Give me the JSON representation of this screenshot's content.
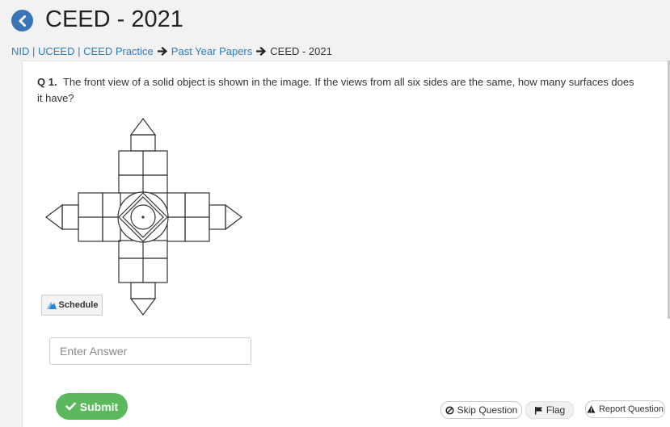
{
  "header": {
    "title": "CEED - 2021",
    "back_icon": "chevron-left-icon",
    "accent": "#3a74b5"
  },
  "breadcrumb": {
    "items": [
      {
        "label": "NID | UCEED | CEED Practice"
      },
      {
        "label": "Past Year Papers"
      }
    ],
    "current": "CEED - 2021",
    "link_color": "#2e7cc0"
  },
  "question": {
    "number": "Q 1.",
    "text": "The front view of a solid object is shown in the image. If the views from all six sides are the same, how many surfaces does it have?"
  },
  "schedule": {
    "label": "Schedule",
    "icon": "schedule-logo-icon"
  },
  "answer": {
    "placeholder": "Enter Answer",
    "value": ""
  },
  "actions": {
    "submit_label": "Submit",
    "submit_color": "#5cb85c",
    "skip_label": "Skip Question",
    "flag_label": "Flag",
    "report_label": "Report Question"
  }
}
